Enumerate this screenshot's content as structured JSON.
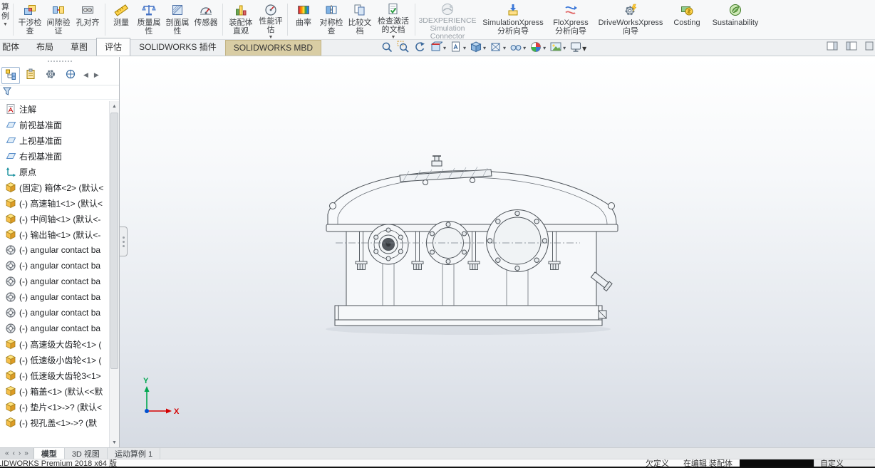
{
  "icons": {
    "dropdown_arrow": "▼",
    "dropdown_small": "▾",
    "chevron_left": "◀",
    "chevron_right": "▶",
    "scroll_up": "▲",
    "scroll_down": "▼",
    "nav_first": "«",
    "nav_prev": "‹",
    "nav_next": "›",
    "nav_last": "»"
  },
  "ribbon": {
    "clipped_button": {
      "char1": "算",
      "char2": "例"
    },
    "buttons": [
      {
        "label": "干涉检查"
      },
      {
        "label": "间隙验证"
      },
      {
        "label": "孔对齐"
      },
      {
        "label": "测量"
      },
      {
        "label": "质量属性"
      },
      {
        "label": "剖面属性"
      },
      {
        "label": "传感器"
      },
      {
        "label": "装配体直观"
      },
      {
        "label": "性能评估"
      },
      {
        "label": "曲率"
      },
      {
        "label": "对称检查"
      },
      {
        "label": "比较文档"
      },
      {
        "label": "检查激活的文档"
      },
      {
        "label": "3DEXPERIENCE Simulation Connector"
      },
      {
        "label": "SimulationXpress 分析向导"
      },
      {
        "label": "FloXpress 分析向导"
      },
      {
        "label": "DriveWorksXpress 向导"
      },
      {
        "label": "Costing"
      },
      {
        "label": "Sustainability"
      }
    ]
  },
  "tab_bar": {
    "tabs": [
      {
        "label": "配体"
      },
      {
        "label": "布局"
      },
      {
        "label": "草图"
      },
      {
        "label": "评估"
      },
      {
        "label": "SOLIDWORKS 插件"
      },
      {
        "label": "SOLIDWORKS MBD"
      }
    ]
  },
  "feature_tree": {
    "items": [
      {
        "label": "注解"
      },
      {
        "label": "前视基准面"
      },
      {
        "label": "上视基准面"
      },
      {
        "label": "右视基准面"
      },
      {
        "label": "原点"
      },
      {
        "label": "(固定) 箱体<2> (默认<"
      },
      {
        "label": "(-) 高速轴1<1> (默认<"
      },
      {
        "label": "(-) 中间轴<1> (默认<-"
      },
      {
        "label": "(-) 输出轴<1> (默认<-"
      },
      {
        "label": "(-) angular contact ba"
      },
      {
        "label": "(-) angular contact ba"
      },
      {
        "label": "(-) angular contact ba"
      },
      {
        "label": "(-) angular contact ba"
      },
      {
        "label": "(-) angular contact ba"
      },
      {
        "label": "(-) angular contact ba"
      },
      {
        "label": "(-) 高速级大齿轮<1> ("
      },
      {
        "label": "(-) 低速级小齿轮<1> ("
      },
      {
        "label": "(-) 低速级大齿轮3<1>"
      },
      {
        "label": "(-) 箱盖<1> (默认<<默"
      },
      {
        "label": "(-) 垫片<1>->? (默认<"
      },
      {
        "label": "(-) 视孔盖<1>->? (默"
      }
    ]
  },
  "viewport": {
    "triad": {
      "x_label": "X",
      "y_label": "Y"
    }
  },
  "doc_tabs": {
    "tabs": [
      {
        "label": "模型"
      },
      {
        "label": "3D 视图"
      },
      {
        "label": "运动算例 1"
      }
    ]
  },
  "status_bar": {
    "left": "LIDWORKS Premium 2018 x64 版",
    "state": "欠定义",
    "editing": "在编辑 装配体",
    "customize": "自定义"
  }
}
